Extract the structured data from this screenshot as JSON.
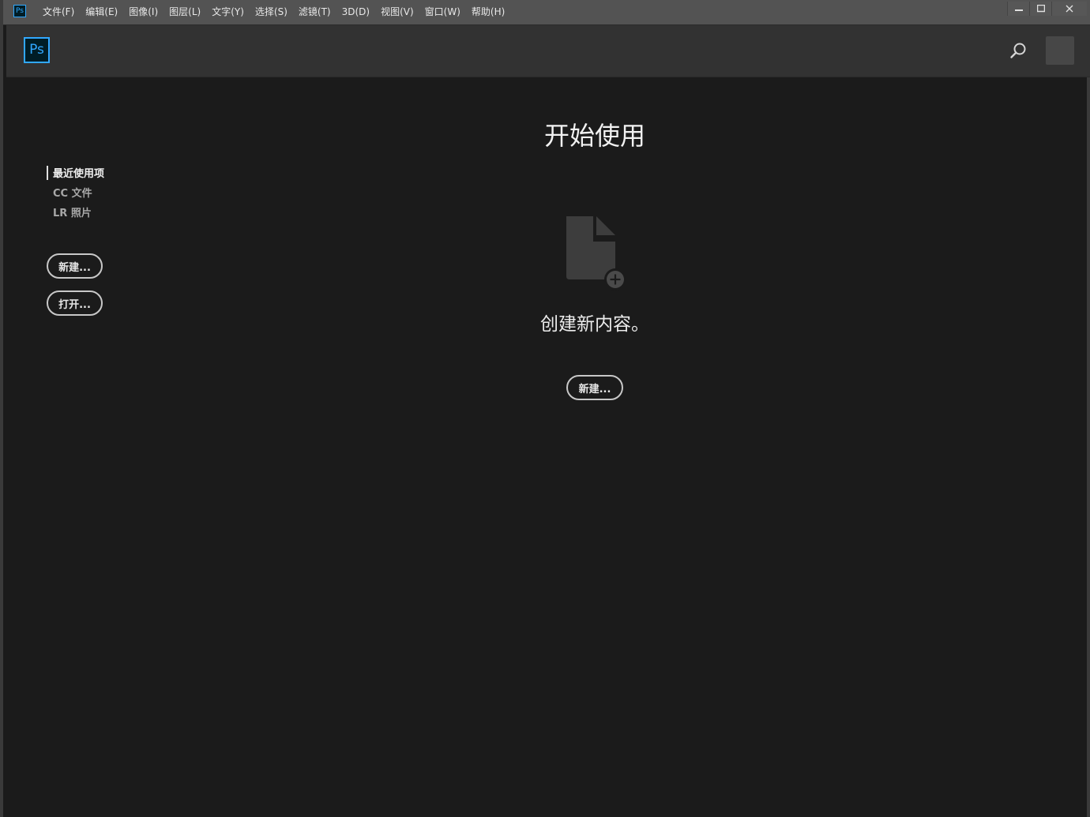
{
  "app": {
    "icon_label": "Ps",
    "logo_label": "Ps"
  },
  "menubar": {
    "items": [
      "文件(F)",
      "编辑(E)",
      "图像(I)",
      "图层(L)",
      "文字(Y)",
      "选择(S)",
      "滤镜(T)",
      "3D(D)",
      "视图(V)",
      "窗口(W)",
      "帮助(H)"
    ]
  },
  "window_controls": {
    "minimize_icon": "minimize-icon",
    "maximize_icon": "maximize-icon",
    "close_icon": "close-icon"
  },
  "header": {
    "search_icon": "search-icon",
    "avatar": "user-avatar"
  },
  "left_nav": {
    "items": [
      {
        "label": "最近使用项",
        "active": true
      },
      {
        "label": "CC 文件",
        "active": false
      },
      {
        "label": "LR 照片",
        "active": false
      }
    ],
    "new_button": "新建...",
    "open_button": "打开..."
  },
  "main": {
    "title": "开始使用",
    "illustration_icon": "new-document-icon",
    "message": "创建新内容。",
    "new_button": "新建..."
  },
  "colors": {
    "accent": "#31a8ff",
    "background": "#1b1b1b",
    "menubar": "#535353",
    "header": "#323232"
  }
}
